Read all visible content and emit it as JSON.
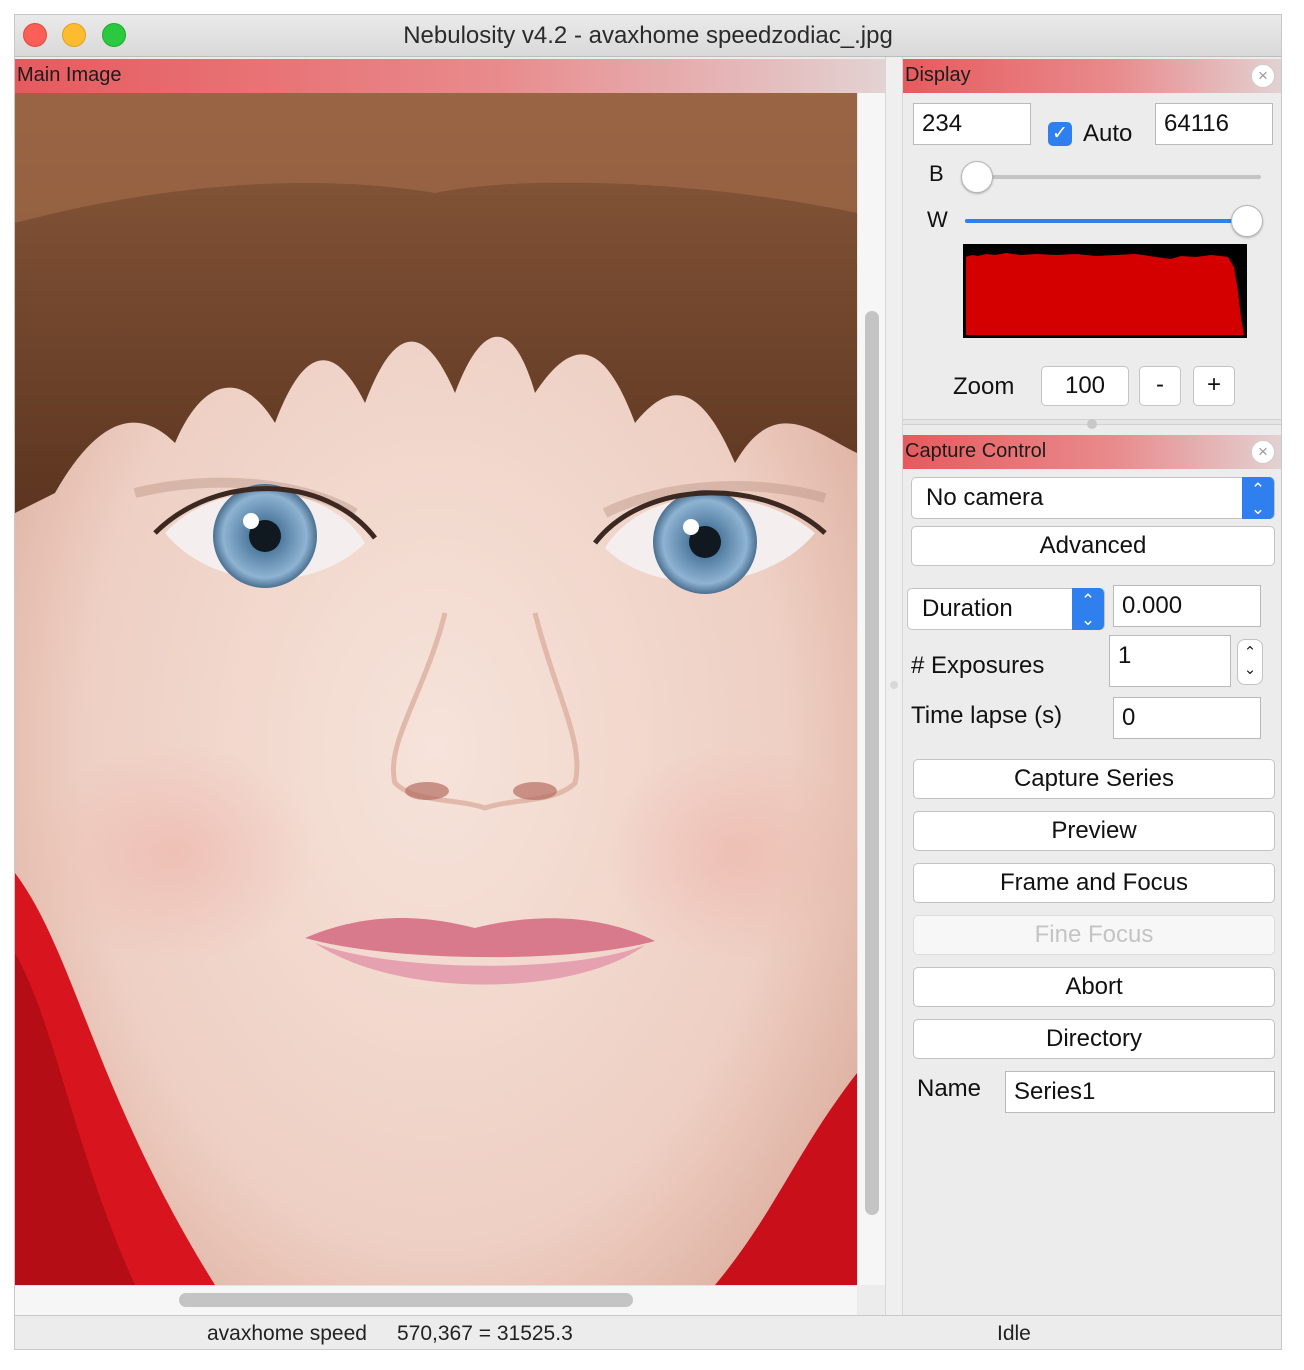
{
  "window": {
    "title": "Nebulosity v4.2 - avaxhome speedzodiac_.jpg"
  },
  "main_image": {
    "header": "Main Image",
    "image_description": "close-up portrait photo of a girl"
  },
  "display": {
    "header": "Display",
    "black_value": "234",
    "auto_label": "Auto",
    "auto_checked": true,
    "white_value": "64116",
    "b_label": "B",
    "w_label": "W",
    "b_slider_level": 0.0,
    "w_slider_level": 0.98,
    "histogram_color": "#d40000",
    "zoom_label": "Zoom",
    "zoom_value": "100",
    "zoom_minus": "-",
    "zoom_plus": "+"
  },
  "capture": {
    "header": "Capture Control",
    "camera_select": "No camera",
    "advanced_button": "Advanced",
    "duration_select": "Duration",
    "duration_value": "0.000",
    "exposures_label": "# Exposures",
    "exposures_value": "1",
    "timelapse_label": "Time lapse (s)",
    "timelapse_value": "0",
    "buttons": {
      "capture_series": "Capture Series",
      "preview": "Preview",
      "frame_and_focus": "Frame and Focus",
      "fine_focus": "Fine Focus",
      "abort": "Abort",
      "directory": "Directory"
    },
    "name_label": "Name",
    "name_value": "Series1"
  },
  "status": {
    "file": "avaxhome speed",
    "coords": "570,367 = 31525.3",
    "state": "Idle"
  },
  "colors": {
    "header_red": "#e65a5e",
    "accent_blue": "#2f7fef"
  }
}
